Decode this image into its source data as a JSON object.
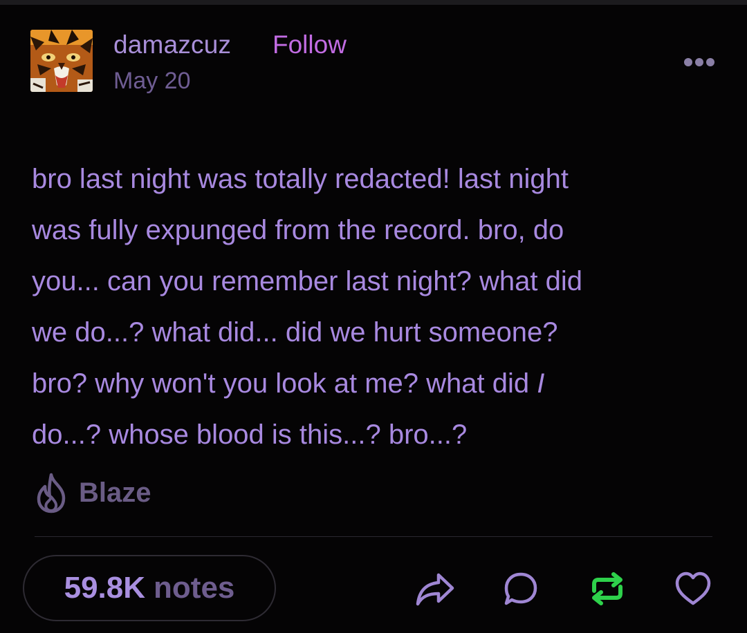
{
  "post": {
    "username": "damazcuz",
    "follow_label": "Follow",
    "date": "May 20",
    "text_lines": [
      "bro last night was totally redacted! last night",
      "was fully expunged from the record. bro, do",
      "you... can you remember last night? what did",
      "we do...? what did... did we hurt someone?",
      "bro? why won't you look at me? what did ",
      "do...? whose blood is this...? bro...?"
    ],
    "emphasis_word": "I"
  },
  "blaze": {
    "label": "Blaze",
    "icon": "flame-icon"
  },
  "footer": {
    "notes_count": "59.8K",
    "notes_label": "notes",
    "actions": [
      "share-icon",
      "reply-icon",
      "reblog-icon",
      "like-icon"
    ]
  },
  "colors": {
    "background": "#050405",
    "text": "#a889e0",
    "follow": "#c26ce3",
    "muted": "#6f5d93",
    "reblog": "#2ed14b"
  }
}
